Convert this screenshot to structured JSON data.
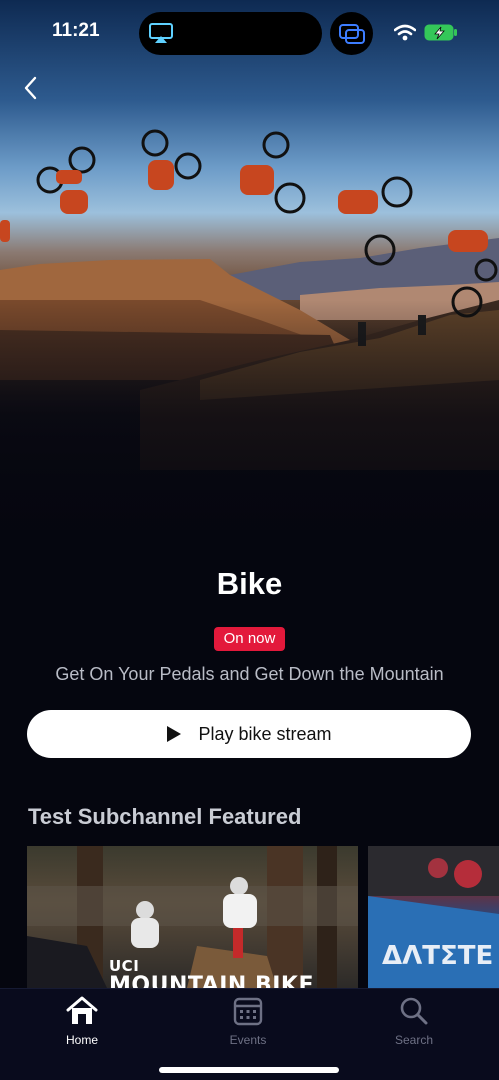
{
  "status_bar": {
    "time": "11:21"
  },
  "hero": {
    "image_description_icon": "bike-flip-sequence-image"
  },
  "channel": {
    "title": "Bike",
    "badge": "On now",
    "subtitle": "Get On Your Pedals and Get Down the Mountain",
    "play_label": "Play bike stream"
  },
  "section": {
    "title": "Test Subchannel Featured",
    "cards": [
      {
        "label_small": "UCI",
        "label_big": "MOUNTAIN BIKE"
      },
      {
        "label_small": "",
        "label_big": ""
      }
    ]
  },
  "tab_bar": {
    "tabs": [
      {
        "label": "Home",
        "icon": "home-icon",
        "active": true
      },
      {
        "label": "Events",
        "icon": "calendar-icon",
        "active": false
      },
      {
        "label": "Search",
        "icon": "search-icon",
        "active": false
      }
    ]
  },
  "colors": {
    "accent": "#e3193b",
    "background": "#05060f",
    "tab_bar": "#090b1d"
  }
}
